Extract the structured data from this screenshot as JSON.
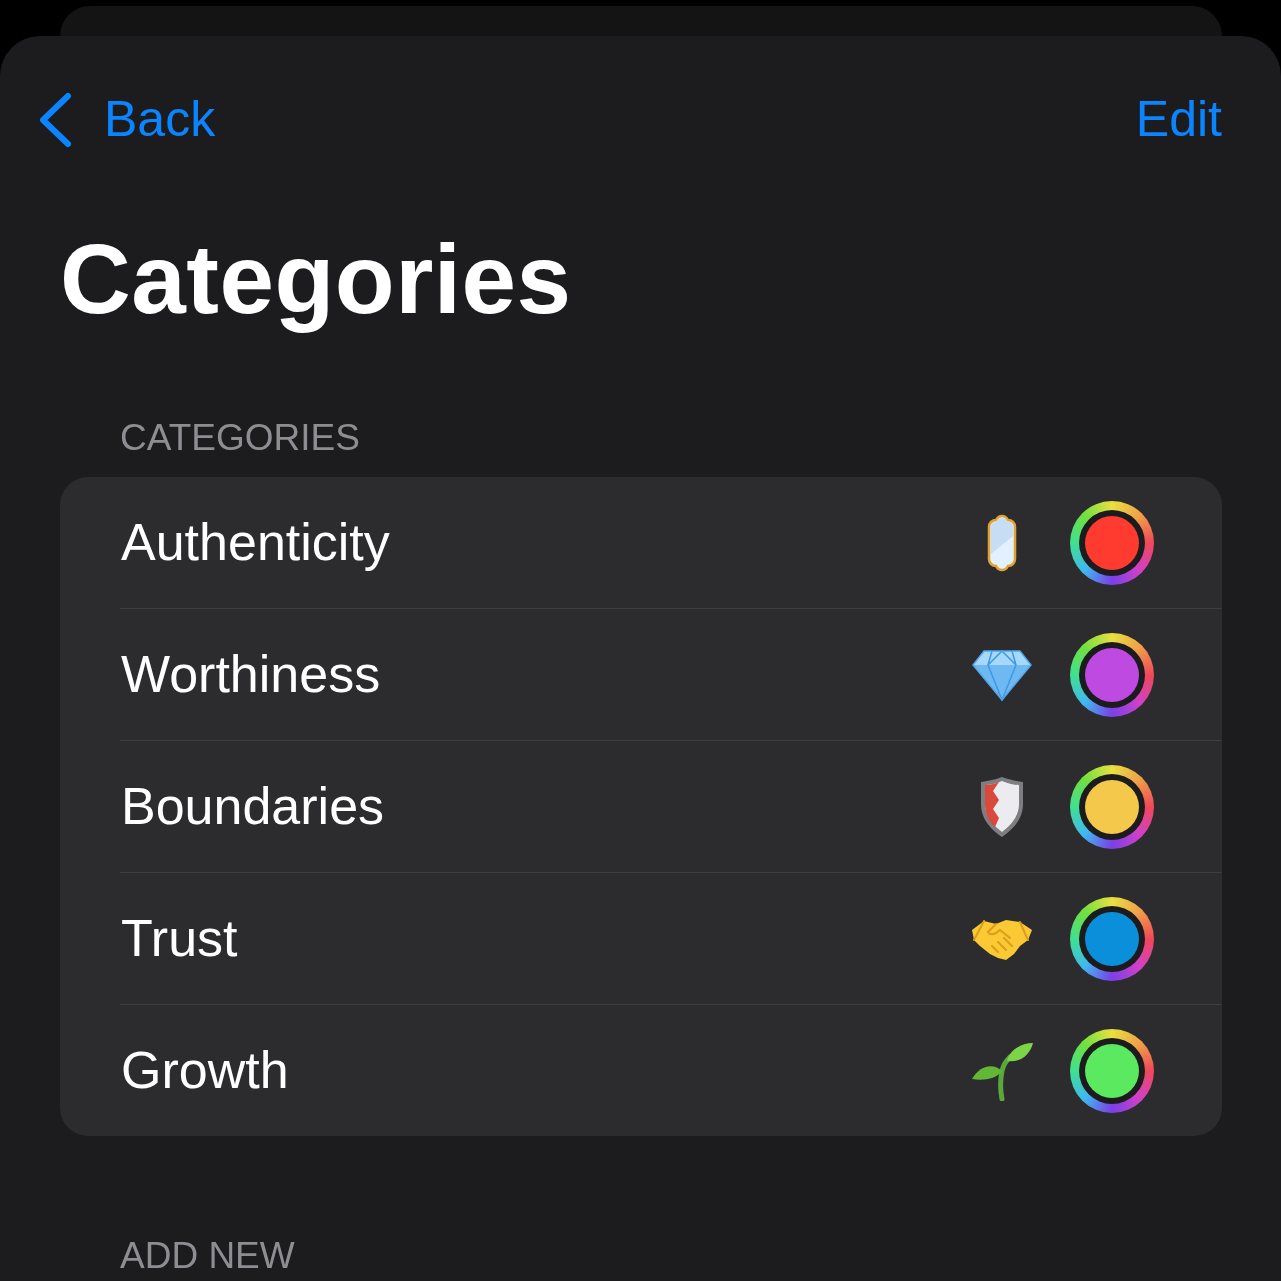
{
  "nav": {
    "back": {
      "label": "Back"
    },
    "edit": {
      "label": "Edit"
    }
  },
  "title": "Categories",
  "categories_section": {
    "header": "CATEGORIES",
    "items": [
      {
        "name": "Authenticity",
        "kind": "mirror",
        "color": "#ff3b30"
      },
      {
        "name": "Worthiness",
        "kind": "gem",
        "color": "#bf4ae2"
      },
      {
        "name": "Boundaries",
        "kind": "shield",
        "color": "#f4c84a"
      },
      {
        "name": "Trust",
        "kind": "handshake",
        "color": "#0b8fdb"
      },
      {
        "name": "Growth",
        "kind": "seedling",
        "color": "#5ae95f"
      }
    ]
  },
  "add_new_section": {
    "header": "ADD NEW"
  }
}
